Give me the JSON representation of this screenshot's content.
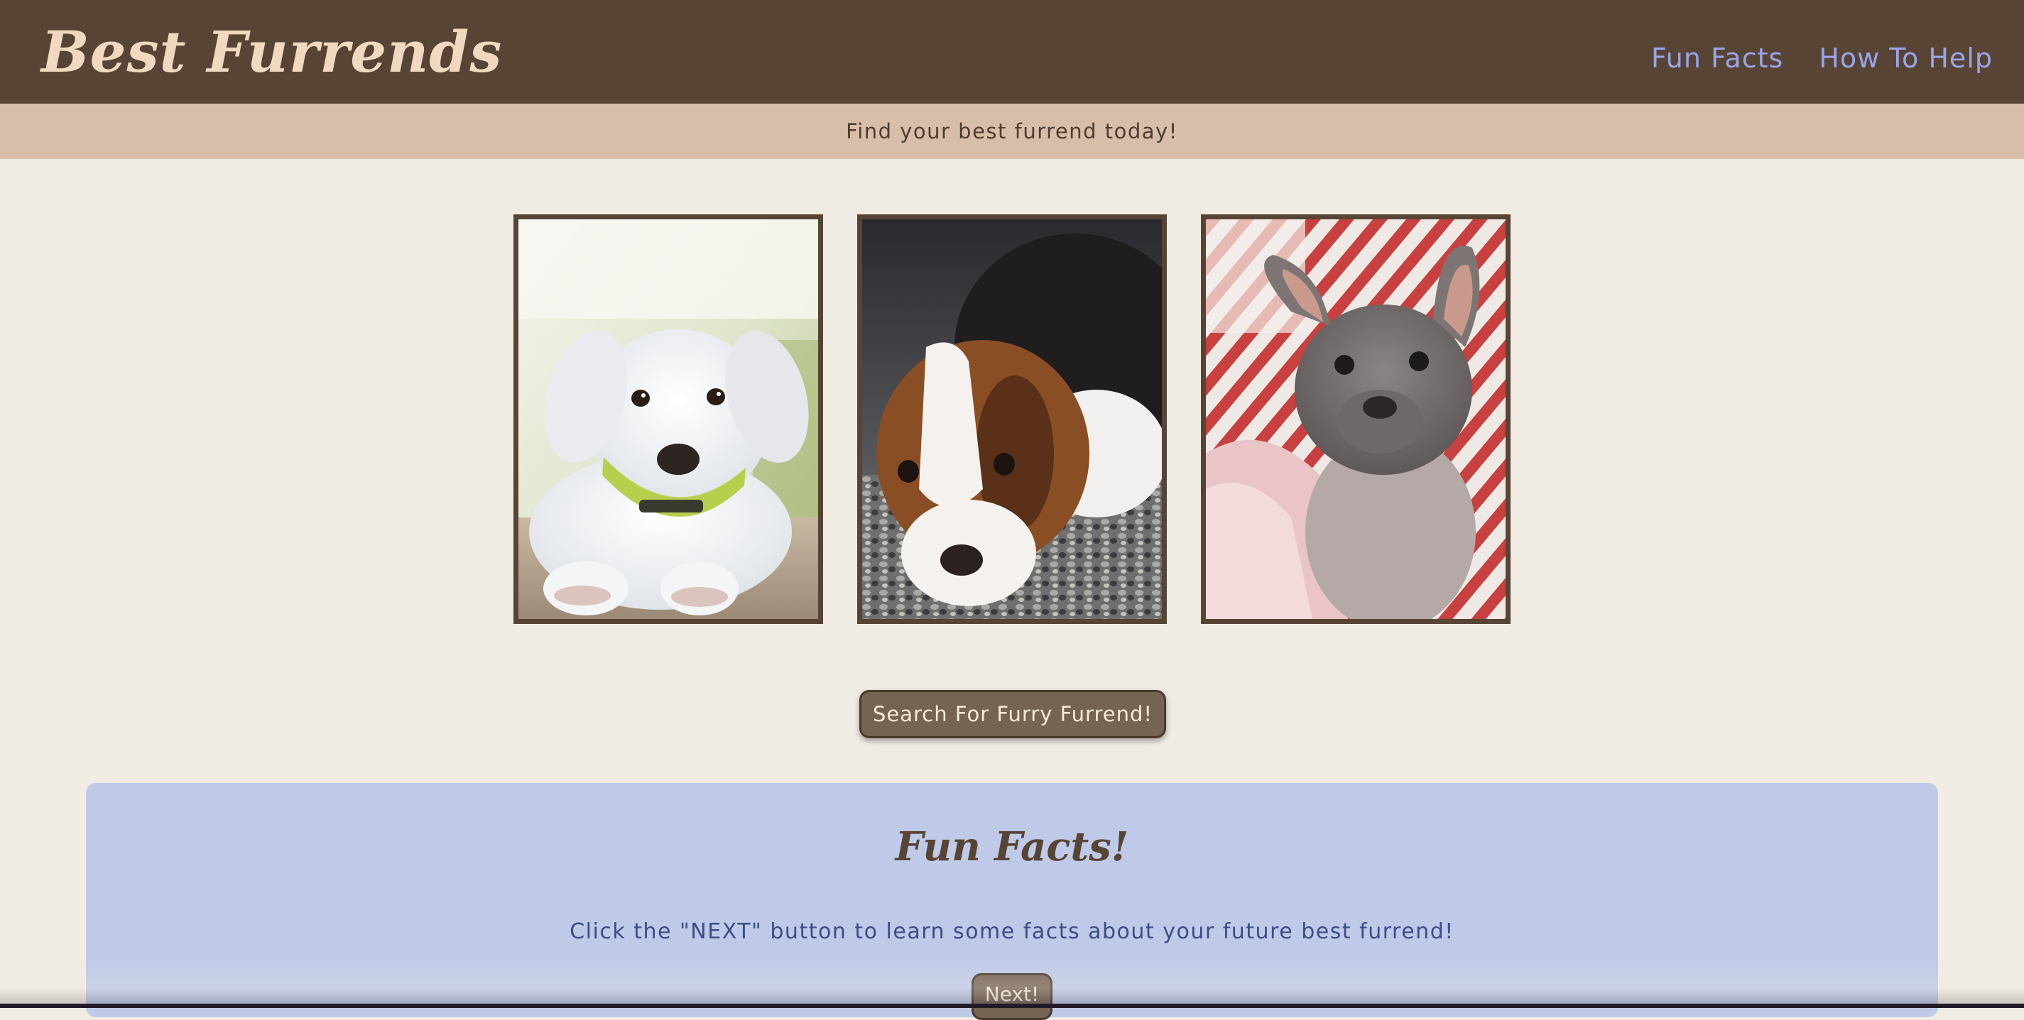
{
  "header": {
    "brand": "Best Furrends",
    "nav": [
      {
        "label": "Fun Facts"
      },
      {
        "label": "How To Help"
      }
    ],
    "background_color": "#574434",
    "brand_color": "#f1d9c1",
    "nav_color": "#9aa5e8"
  },
  "tagline": {
    "text": "Find your best furrend today!",
    "background_color": "#d8bda9"
  },
  "gallery": {
    "photos": [
      {
        "icon": "white-puppy-photo"
      },
      {
        "icon": "beagle-puppy-photo"
      },
      {
        "icon": "french-bulldog-puppy-photo"
      }
    ],
    "frame_color": "#574434"
  },
  "search": {
    "button_label": "Search For Furry Furrend!"
  },
  "fun_facts": {
    "title": "Fun Facts!",
    "text": "Click the \"NEXT\" button to learn some facts about your future best furrend!",
    "next_label": "Next!",
    "background_color": "#bfcae8"
  }
}
